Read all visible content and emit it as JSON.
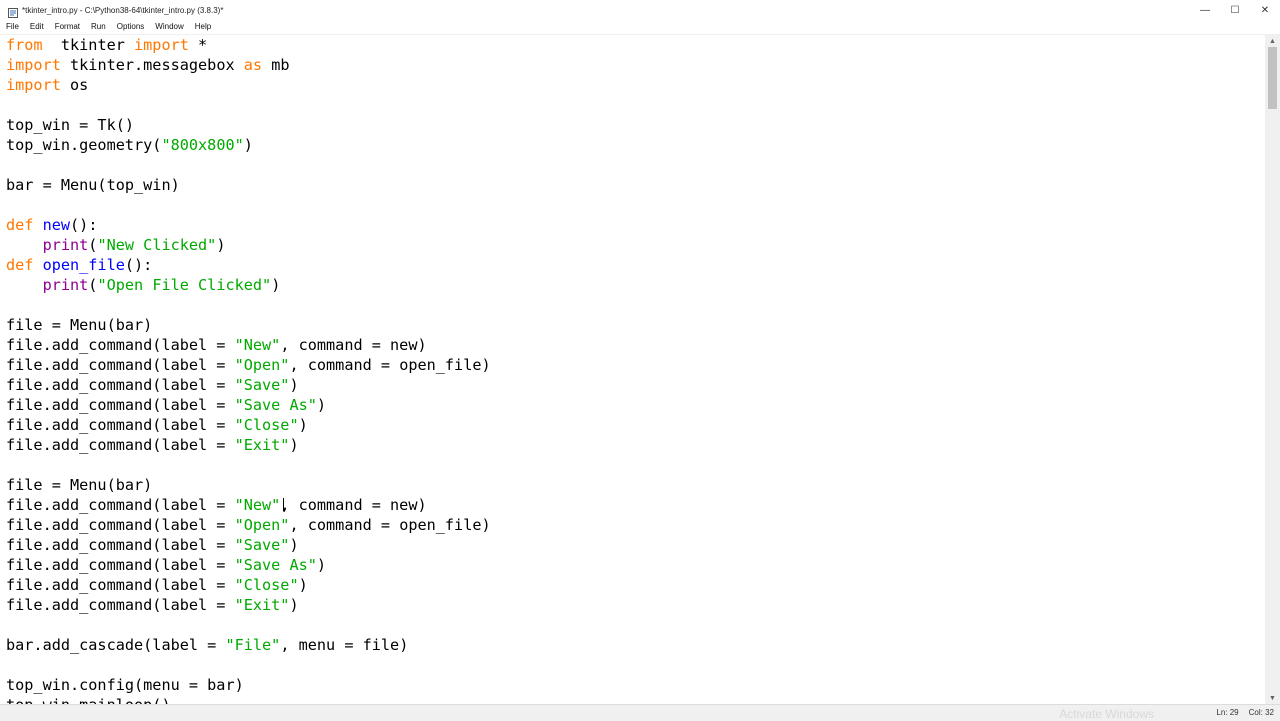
{
  "window": {
    "title": "*tkinter_intro.py - C:\\Python38-64\\tkinter_intro.py (3.8.3)*",
    "minimize_glyph": "—",
    "maximize_glyph": "☐",
    "close_glyph": "✕"
  },
  "menubar": {
    "items": [
      "File",
      "Edit",
      "Format",
      "Run",
      "Options",
      "Window",
      "Help"
    ]
  },
  "code": {
    "lines": [
      [
        [
          "kw",
          "from"
        ],
        [
          "",
          "  tkinter "
        ],
        [
          "kw",
          "import"
        ],
        [
          "",
          " *"
        ]
      ],
      [
        [
          "kw",
          "import"
        ],
        [
          "",
          " tkinter.messagebox "
        ],
        [
          "kw",
          "as"
        ],
        [
          "",
          " mb"
        ]
      ],
      [
        [
          "kw",
          "import"
        ],
        [
          "",
          " os"
        ]
      ],
      [],
      [
        [
          "",
          "top_win = Tk()"
        ]
      ],
      [
        [
          "",
          "top_win.geometry("
        ],
        [
          "st",
          "\"800x800\""
        ],
        [
          "",
          ")"
        ]
      ],
      [],
      [
        [
          "",
          "bar = Menu(top_win)"
        ]
      ],
      [],
      [
        [
          "kw",
          "def"
        ],
        [
          "",
          " "
        ],
        [
          "df",
          "new"
        ],
        [
          "",
          "():"
        ]
      ],
      [
        [
          "",
          "    "
        ],
        [
          "bi",
          "print"
        ],
        [
          "",
          "("
        ],
        [
          "st",
          "\"New Clicked\""
        ],
        [
          "",
          ")"
        ]
      ],
      [
        [
          "kw",
          "def"
        ],
        [
          "",
          " "
        ],
        [
          "df",
          "open_file"
        ],
        [
          "",
          "():"
        ]
      ],
      [
        [
          "",
          "    "
        ],
        [
          "bi",
          "print"
        ],
        [
          "",
          "("
        ],
        [
          "st",
          "\"Open File Clicked\""
        ],
        [
          "",
          ")"
        ]
      ],
      [],
      [
        [
          "",
          "file = Menu(bar)"
        ]
      ],
      [
        [
          "",
          "file.add_command(label = "
        ],
        [
          "st",
          "\"New\""
        ],
        [
          "",
          ", command = new)"
        ]
      ],
      [
        [
          "",
          "file.add_command(label = "
        ],
        [
          "st",
          "\"Open\""
        ],
        [
          "",
          ", command = open_file)"
        ]
      ],
      [
        [
          "",
          "file.add_command(label = "
        ],
        [
          "st",
          "\"Save\""
        ],
        [
          "",
          ")"
        ]
      ],
      [
        [
          "",
          "file.add_command(label = "
        ],
        [
          "st",
          "\"Save As\""
        ],
        [
          "",
          ")"
        ]
      ],
      [
        [
          "",
          "file.add_command(label = "
        ],
        [
          "st",
          "\"Close\""
        ],
        [
          "",
          ")"
        ]
      ],
      [
        [
          "",
          "file.add_command(label = "
        ],
        [
          "st",
          "\"Exit\""
        ],
        [
          "",
          ")"
        ]
      ],
      [],
      [
        [
          "",
          "file = Menu(bar)"
        ]
      ],
      [
        [
          "",
          "file.add_command(label = "
        ],
        [
          "st",
          "\"New\""
        ],
        [
          "",
          ", command = new)"
        ]
      ],
      [
        [
          "",
          "file.add_command(label = "
        ],
        [
          "st",
          "\"Open\""
        ],
        [
          "",
          ", command = open_file)"
        ]
      ],
      [
        [
          "",
          "file.add_command(label = "
        ],
        [
          "st",
          "\"Save\""
        ],
        [
          "",
          ")"
        ]
      ],
      [
        [
          "",
          "file.add_command(label = "
        ],
        [
          "st",
          "\"Save As\""
        ],
        [
          "",
          ")"
        ]
      ],
      [
        [
          "",
          "file.add_command(label = "
        ],
        [
          "st",
          "\"Close\""
        ],
        [
          "",
          ")"
        ]
      ],
      [
        [
          "",
          "file.add_command(label = "
        ],
        [
          "st",
          "\"Exit\""
        ],
        [
          "",
          ")"
        ]
      ],
      [],
      [
        [
          "",
          "bar.add_cascade(label = "
        ],
        [
          "st",
          "\"File\""
        ],
        [
          "",
          ", menu = file)"
        ]
      ],
      [],
      [
        [
          "",
          "top_win.config(menu = bar)"
        ]
      ],
      [
        [
          "",
          "top_win.mainloop()"
        ]
      ]
    ]
  },
  "colors": {
    "keyword": "#ff7700",
    "string": "#00aa00",
    "builtin": "#900090",
    "definition": "#0000ff"
  },
  "status": {
    "line": "Ln: 29",
    "col": "Col: 32"
  },
  "watermark": "Activate Windows"
}
